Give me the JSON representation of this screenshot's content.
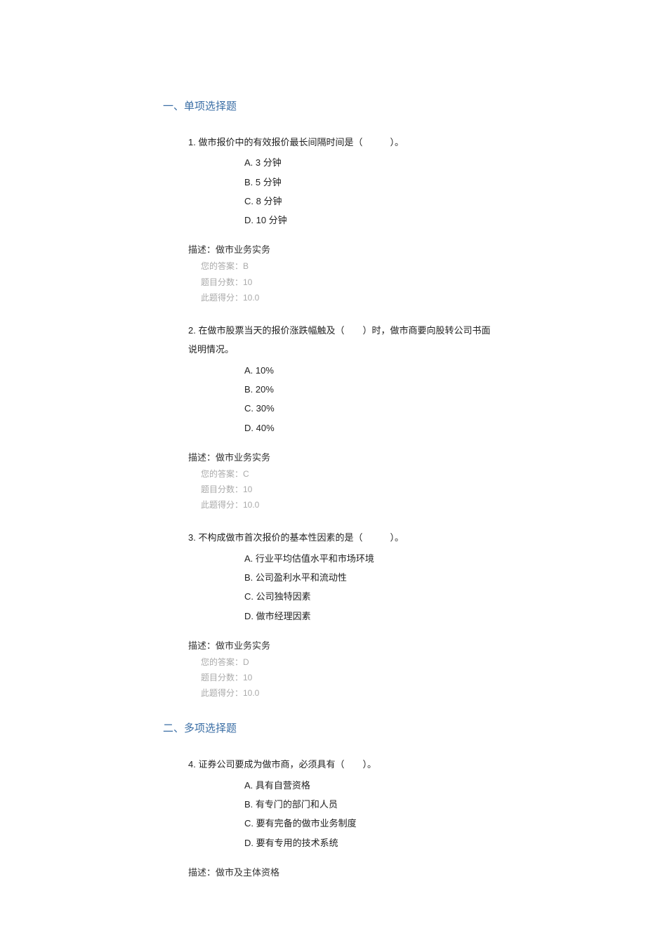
{
  "sections": {
    "s1": {
      "title": "一、单项选择题",
      "questions": {
        "q1": {
          "text": "1. 做市报价中的有效报价最长间隔时间是（　　　）。",
          "opts": {
            "a": "A. 3 分钟",
            "b": "B. 5 分钟",
            "c": "C. 8 分钟",
            "d": "D. 10 分钟"
          },
          "desc": "描述：做市业务实务",
          "ans": "您的答案：B",
          "pts": "题目分数：10",
          "score": "此题得分：10.0"
        },
        "q2": {
          "text": "2. 在做市股票当天的报价涨跌幅触及（　　）时，做市商要向股转公司书面说明情况。",
          "opts": {
            "a": "A. 10%",
            "b": "B. 20%",
            "c": "C. 30%",
            "d": "D. 40%"
          },
          "desc": "描述：做市业务实务",
          "ans": "您的答案：C",
          "pts": "题目分数：10",
          "score": "此题得分：10.0"
        },
        "q3": {
          "text": "3. 不构成做市首次报价的基本性因素的是（　　　）。",
          "opts": {
            "a": "A. 行业平均估值水平和市场环境",
            "b": "B. 公司盈利水平和流动性",
            "c": "C. 公司独特因素",
            "d": "D. 做市经理因素"
          },
          "desc": "描述：做市业务实务",
          "ans": "您的答案：D",
          "pts": "题目分数：10",
          "score": "此题得分：10.0"
        }
      }
    },
    "s2": {
      "title": "二、多项选择题",
      "questions": {
        "q4": {
          "text": "4. 证券公司要成为做市商，必须具有（　　）。",
          "opts": {
            "a": "A. 具有自营资格",
            "b": "B. 有专门的部门和人员",
            "c": "C. 要有完备的做市业务制度",
            "d": "D. 要有专用的技术系统"
          },
          "desc": "描述：做市及主体资格"
        }
      }
    }
  }
}
